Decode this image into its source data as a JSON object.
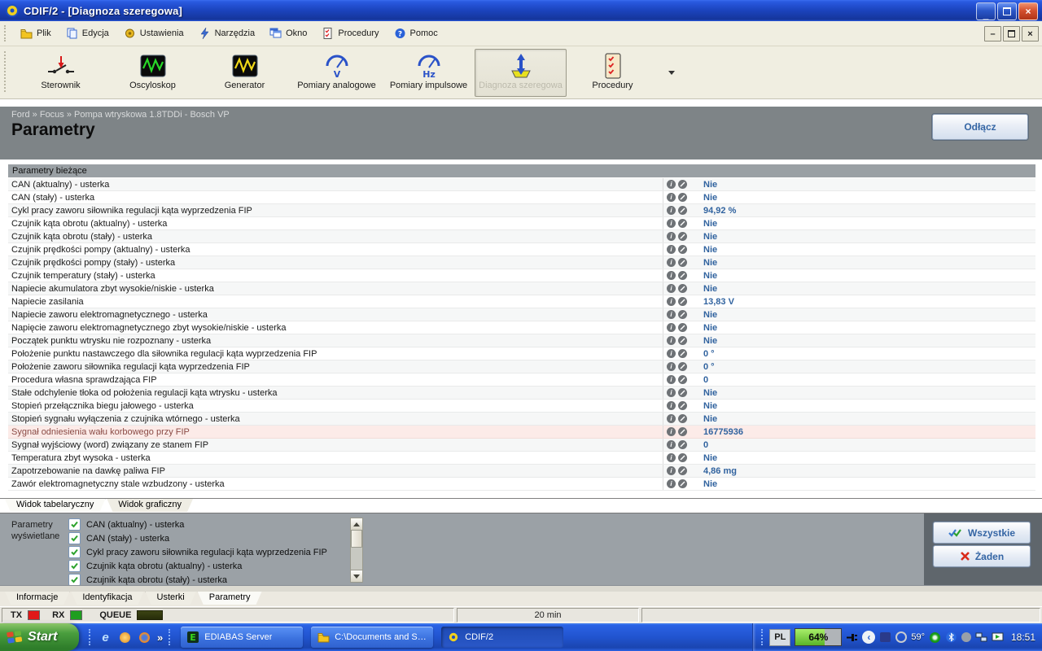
{
  "window": {
    "title": "CDIF/2 - [Diagnoza szeregowa]"
  },
  "menu": {
    "items": [
      {
        "label": "Plik"
      },
      {
        "label": "Edycja"
      },
      {
        "label": "Ustawienia"
      },
      {
        "label": "Narzędzia"
      },
      {
        "label": "Okno"
      },
      {
        "label": "Procedury"
      },
      {
        "label": "Pomoc"
      }
    ]
  },
  "toolbar": {
    "buttons": [
      {
        "label": "Sterownik",
        "icon": "controller-switch-icon"
      },
      {
        "label": "Oscyloskop",
        "icon": "oscilloscope-icon"
      },
      {
        "label": "Generator",
        "icon": "generator-icon"
      },
      {
        "label": "Pomiary analogowe",
        "icon": "analog-gauge-icon"
      },
      {
        "label": "Pomiary impulsowe",
        "icon": "impulse-gauge-icon"
      },
      {
        "label": "Diagnoza szeregowa",
        "icon": "serial-diagnosis-icon",
        "active": true
      },
      {
        "label": "Procedury",
        "icon": "procedures-icon"
      }
    ]
  },
  "header": {
    "breadcrumb": "Ford » Focus » Pompa wtryskowa 1.8TDDi - Bosch VP",
    "title": "Parametry",
    "disconnect": "Odłącz"
  },
  "parameters": {
    "section": "Parametry bieżące",
    "rows": [
      {
        "name": "CAN (aktualny) - usterka",
        "value": "Nie"
      },
      {
        "name": "CAN (stały) - usterka",
        "value": "Nie"
      },
      {
        "name": "Cykl pracy zaworu siłownika regulacji kąta wyprzedzenia FIP",
        "value": "94,92 %"
      },
      {
        "name": "Czujnik kąta obrotu (aktualny) - usterka",
        "value": "Nie"
      },
      {
        "name": "Czujnik kąta obrotu (stały) - usterka",
        "value": "Nie"
      },
      {
        "name": "Czujnik prędkości pompy (aktualny) - usterka",
        "value": "Nie"
      },
      {
        "name": "Czujnik prędkości pompy (stały) - usterka",
        "value": "Nie"
      },
      {
        "name": "Czujnik temperatury (stały) - usterka",
        "value": "Nie"
      },
      {
        "name": "Napiecie akumulatora zbyt wysokie/niskie - usterka",
        "value": "Nie"
      },
      {
        "name": "Napiecie zasilania",
        "value": "13,83 V"
      },
      {
        "name": "Napiecie zaworu elektromagnetycznego - usterka",
        "value": "Nie"
      },
      {
        "name": "Napięcie zaworu elektromagnetycznego zbyt wysokie/niskie - usterka",
        "value": "Nie"
      },
      {
        "name": "Początek punktu wtrysku nie rozpoznany - usterka",
        "value": "Nie"
      },
      {
        "name": "Położenie punktu nastawczego dla siłownika regulacji kąta wyprzedzenia FIP",
        "value": "0 °"
      },
      {
        "name": "Położenie zaworu siłownika regulacji kąta wyprzedzenia FIP",
        "value": "0 °"
      },
      {
        "name": "Procedura własna sprawdzająca FIP",
        "value": "0"
      },
      {
        "name": "Stałe odchylenie tłoka od położenia regulacji kąta wtrysku - usterka",
        "value": "Nie"
      },
      {
        "name": "Stopień przełącznika biegu jałowego - usterka",
        "value": "Nie"
      },
      {
        "name": "Stopień sygnału wyłączenia z czujnika wtórnego - usterka",
        "value": "Nie"
      },
      {
        "name": "Sygnał odniesienia wału korbowego przy FIP",
        "value": "16775936",
        "highlighted": true
      },
      {
        "name": "Sygnał wyjściowy (word) związany ze stanem FIP",
        "value": "0"
      },
      {
        "name": "Temperatura zbyt wysoka - usterka",
        "value": "Nie"
      },
      {
        "name": "Zapotrzebowanie na dawkę paliwa FIP",
        "value": "4,86 mg"
      },
      {
        "name": "Zawór elektromagnetyczny stale wzbudzony - usterka",
        "value": "Nie"
      }
    ]
  },
  "view_tabs": [
    {
      "label": "Widok tabelaryczny",
      "active": true
    },
    {
      "label": "Widok graficzny",
      "active": false
    }
  ],
  "display": {
    "label": "Parametry wyświetlane",
    "items": [
      {
        "label": "CAN (aktualny) - usterka",
        "checked": true
      },
      {
        "label": "CAN (stały) - usterka",
        "checked": true
      },
      {
        "label": "Cykl pracy zaworu siłownika regulacji kąta wyprzedzenia FIP",
        "checked": true
      },
      {
        "label": "Czujnik kąta obrotu (aktualny) - usterka",
        "checked": true
      },
      {
        "label": "Czujnik kąta obrotu (stały) - usterka",
        "checked": true
      }
    ],
    "all": "Wszystkie",
    "none": "Żaden"
  },
  "bottom_tabs": [
    {
      "label": "Informacje",
      "active": false
    },
    {
      "label": "Identyfikacja",
      "active": false
    },
    {
      "label": "Usterki",
      "active": false
    },
    {
      "label": "Parametry",
      "active": true
    }
  ],
  "status": {
    "tx": "TX",
    "rx": "RX",
    "queue": "QUEUE",
    "elapsed": "20 min"
  },
  "taskbar": {
    "start": "Start",
    "tasks": [
      {
        "label": "EDIABAS Server",
        "active": false
      },
      {
        "label": "C:\\Documents and Se...",
        "active": false
      },
      {
        "label": "CDIF/2",
        "active": true
      }
    ],
    "tray": {
      "lang": "PL",
      "battery": "64%",
      "temp": "59°",
      "clock": "18:51"
    }
  }
}
